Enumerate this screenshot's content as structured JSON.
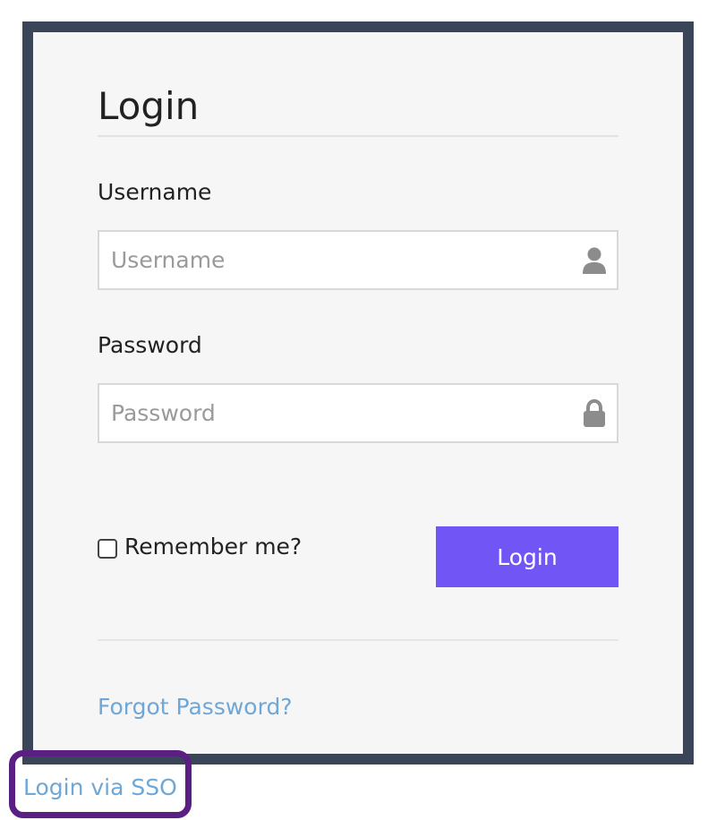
{
  "login_form": {
    "title": "Login",
    "username": {
      "label": "Username",
      "placeholder": "Username",
      "value": "",
      "icon": "user-icon"
    },
    "password": {
      "label": "Password",
      "placeholder": "Password",
      "value": "",
      "icon": "lock-icon"
    },
    "remember_me": {
      "label": "Remember me?",
      "checked": false
    },
    "login_button_label": "Login",
    "forgot_password_link": "Forgot Password?"
  },
  "sso_link": "Login via SSO",
  "colors": {
    "panel_border": "#3b4558",
    "panel_background": "#f6f6f6",
    "primary_button": "#7156f5",
    "link": "#6fa7d6",
    "highlight_outline": "#5b1f83"
  }
}
